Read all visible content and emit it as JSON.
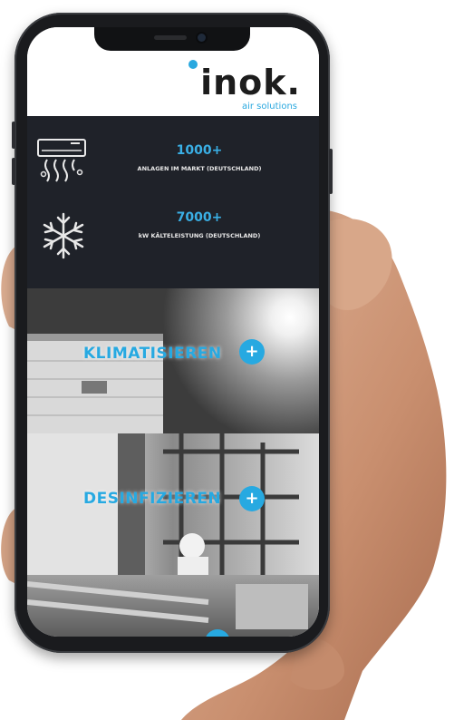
{
  "brand": {
    "name": "inok.",
    "tagline": "air solutions",
    "accent": "#29a8df"
  },
  "stats": [
    {
      "icon": "air-conditioner-icon",
      "value": "1000+",
      "label": "ANLAGEN IM MARKT (DEUTSCHLAND)"
    },
    {
      "icon": "snowflake-icon",
      "value": "7000+",
      "label": "kW KÄLTELEISTUNG (DEUTSCHLAND)"
    }
  ],
  "sections": [
    {
      "title": "KLIMATISIEREN",
      "plus": "+"
    },
    {
      "title": "DESINFIZIEREN",
      "plus": "+"
    }
  ],
  "colors": {
    "stats_bg": "#1f2229",
    "accent": "#27a9e1",
    "phone": "#1a1b1e"
  }
}
